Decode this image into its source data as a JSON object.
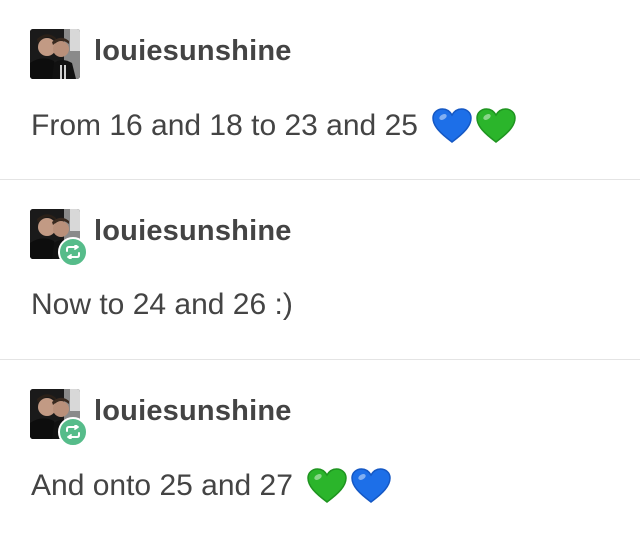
{
  "posts": [
    {
      "username": "louiesunshine",
      "reblog": false,
      "text": "From 16 and 18 to 23 and 25",
      "emoji": [
        {
          "name": "blue-heart",
          "color": "#1d6fe8"
        },
        {
          "name": "green-heart",
          "color": "#2bb52b"
        }
      ]
    },
    {
      "username": "louiesunshine",
      "reblog": true,
      "text": "Now to 24 and 26 :)",
      "emoji": []
    },
    {
      "username": "louiesunshine",
      "reblog": true,
      "text": "And onto 25 and 27",
      "emoji": [
        {
          "name": "green-heart",
          "color": "#2bb52b"
        },
        {
          "name": "blue-heart",
          "color": "#1d6fe8"
        }
      ]
    }
  ],
  "colors": {
    "text": "#444444",
    "divider": "#e4e4e4",
    "reblog_badge": "#56bc8a"
  }
}
